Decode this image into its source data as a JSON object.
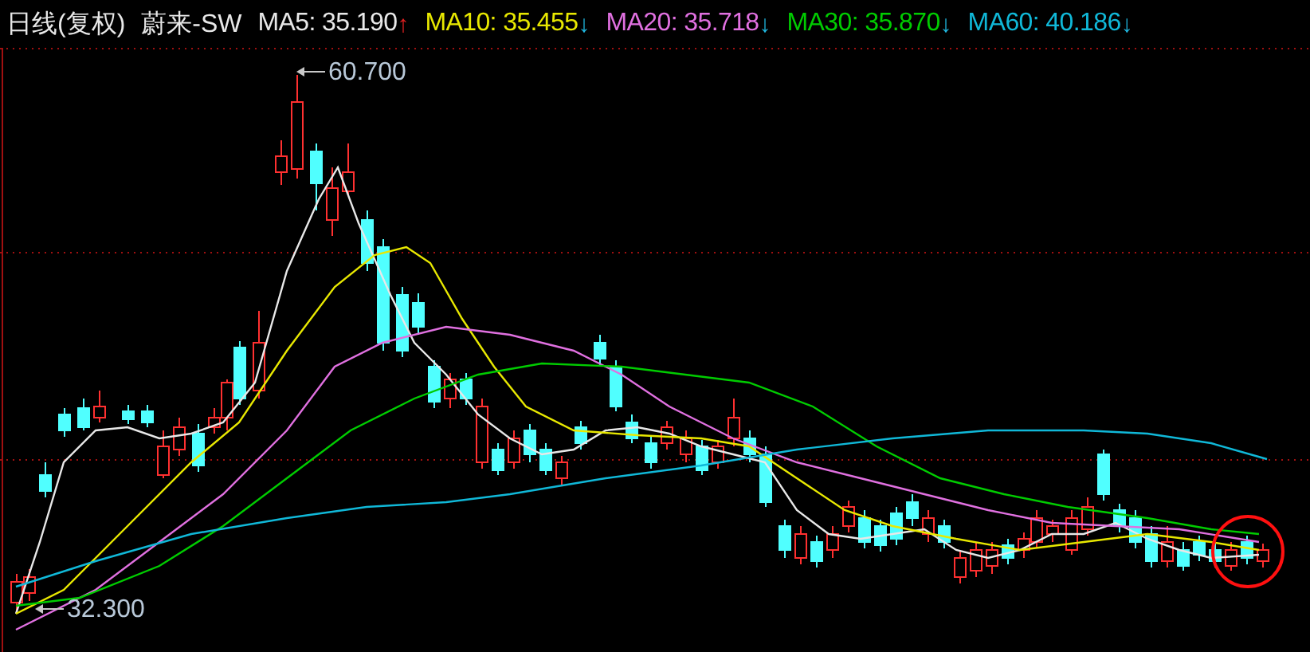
{
  "header": {
    "period": "日线(复权)",
    "stock_name": "蔚来-SW",
    "moving_averages": [
      {
        "label": "MA5: 35.190",
        "arrow": "↑",
        "rising": true,
        "color": "#e8e8e8"
      },
      {
        "label": "MA10: 35.455",
        "arrow": "↓",
        "rising": false,
        "color": "#e8e800"
      },
      {
        "label": "MA20: 35.718",
        "arrow": "↓",
        "rising": false,
        "color": "#e070e0"
      },
      {
        "label": "MA30: 35.870",
        "arrow": "↓",
        "rising": false,
        "color": "#00cc00"
      },
      {
        "label": "MA60: 40.186",
        "arrow": "↓",
        "rising": false,
        "color": "#10b8d8"
      }
    ]
  },
  "chart": {
    "high_label": "60.700",
    "low_label": "32.300"
  }
}
